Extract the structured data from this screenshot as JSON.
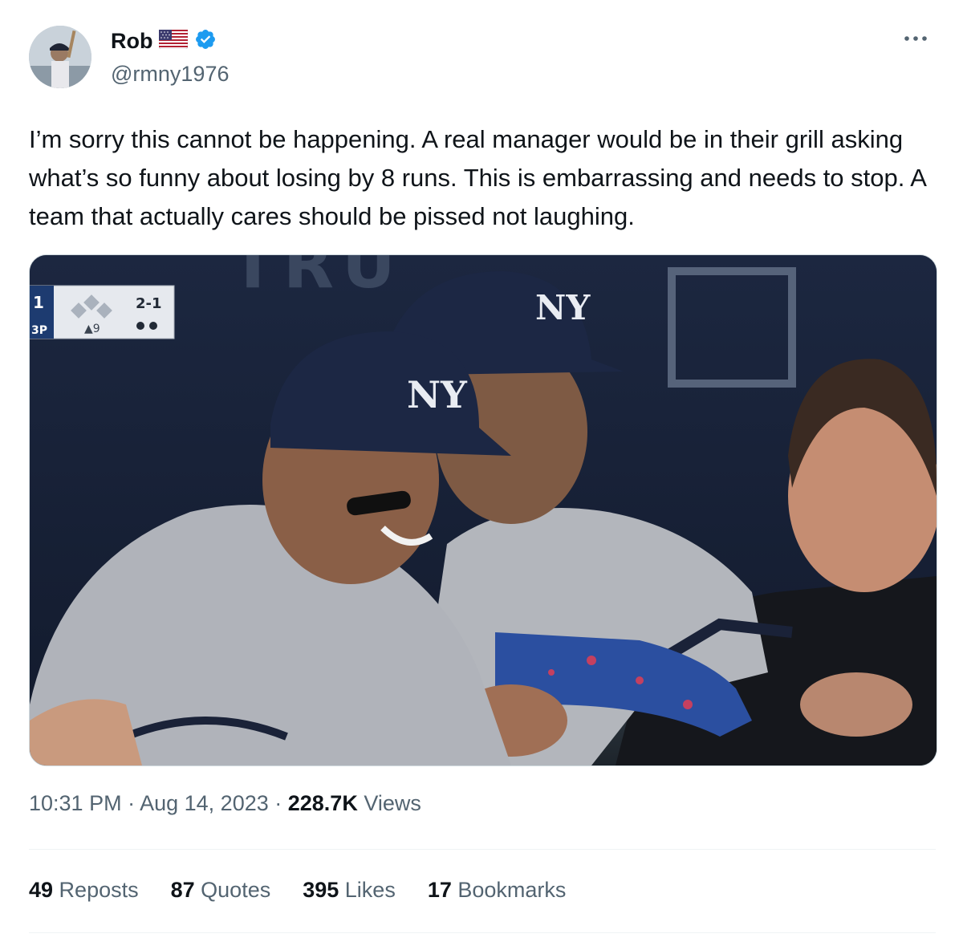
{
  "author": {
    "name": "Rob",
    "flag": "🇺🇸",
    "handle": "@rmny1976",
    "verified_color": "#1d9bf0"
  },
  "more_icon": "more-horizontal-icon",
  "tweet": {
    "text": "I’m sorry this cannot be happening. A real manager would be in their grill asking what’s so funny about losing by 8 runs. This is embarrassing and needs to stop. A team that actually cares should be pissed not laughing."
  },
  "media": {
    "scorebug": {
      "inning": "1",
      "count": "2-1",
      "team": "3P",
      "pitch": "▲9"
    },
    "cap_logo": "NY",
    "background_sign": "TRU"
  },
  "meta": {
    "time": "10:31 PM",
    "sep1": " · ",
    "date": "Aug 14, 2023",
    "sep2": " · ",
    "views_count": "228.7K",
    "views_label": " Views"
  },
  "stats": [
    {
      "count": "49",
      "label": " Reposts"
    },
    {
      "count": "87",
      "label": " Quotes"
    },
    {
      "count": "395",
      "label": " Likes"
    },
    {
      "count": "17",
      "label": " Bookmarks"
    }
  ],
  "colors": {
    "text": "#0f1419",
    "secondary": "#536471",
    "divider": "#eff3f4",
    "accent": "#1d9bf0"
  }
}
